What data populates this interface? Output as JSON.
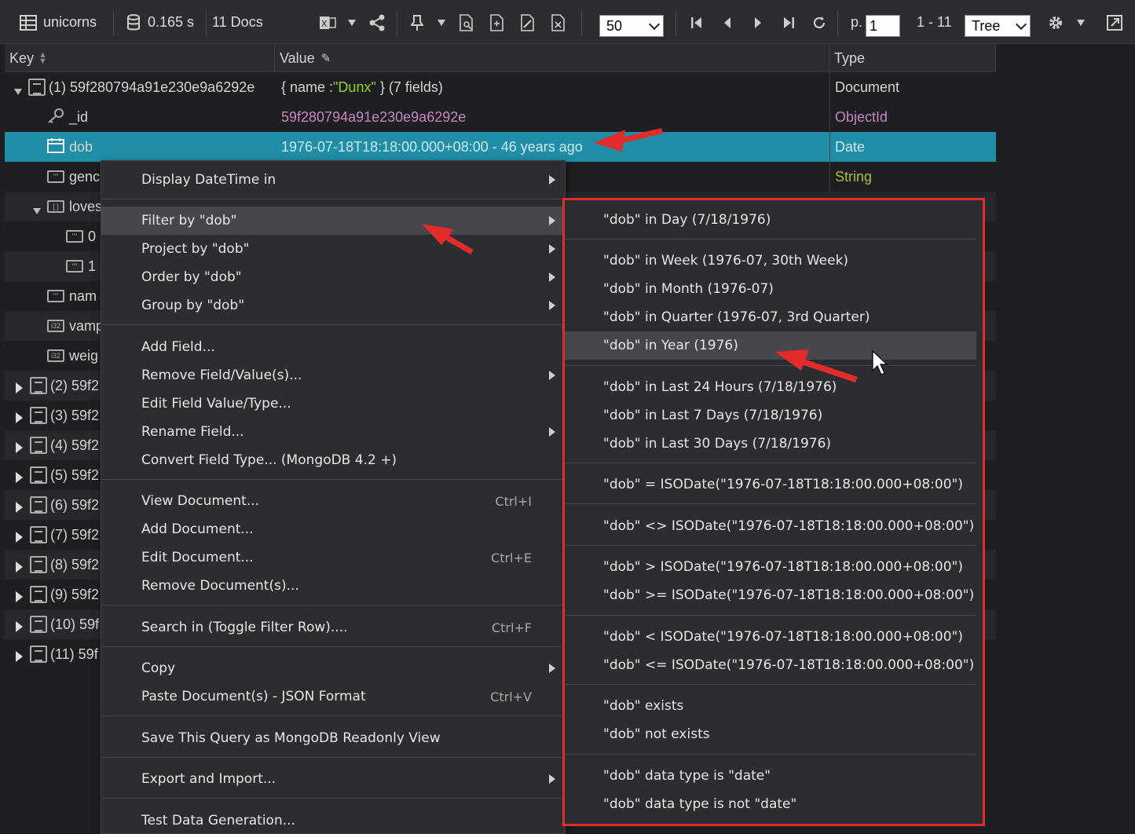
{
  "toolbar": {
    "collection": "unicorns",
    "time": "0.165 s",
    "docs": "11 Docs",
    "page_size": "50",
    "page_label": "p.",
    "page_value": "1",
    "range": "1 - 11",
    "view_mode": "Tree"
  },
  "columns": {
    "key": "Key",
    "value": "Value",
    "type": "Type"
  },
  "rows": [
    {
      "key": "(1) 59f280794a91e230e9a6292e",
      "value_pre": "{ name : ",
      "value_str": "\"Dunx\"",
      "value_post": " } (7 fields)",
      "type": "Document"
    },
    {
      "key": "_id",
      "value": "59f280794a91e230e9a6292e",
      "type": "ObjectId"
    },
    {
      "key": "dob",
      "value": "1976-07-18T18:18:00.000+08:00 - 46 years ago",
      "type": "Date"
    },
    {
      "key": "genc",
      "type": "String"
    },
    {
      "key": "loves"
    },
    {
      "key": "0"
    },
    {
      "key": "1"
    },
    {
      "key": "nam"
    },
    {
      "key": "vamp"
    },
    {
      "key": "weig"
    },
    {
      "key": "(2) 59f2"
    },
    {
      "key": "(3) 59f2"
    },
    {
      "key": "(4) 59f2"
    },
    {
      "key": "(5) 59f2"
    },
    {
      "key": "(6) 59f2"
    },
    {
      "key": "(7) 59f2"
    },
    {
      "key": "(8) 59f2"
    },
    {
      "key": "(9) 59f2"
    },
    {
      "key": "(10) 59f"
    },
    {
      "key": "(11) 59f"
    }
  ],
  "menu": {
    "display_datetime": "Display DateTime in",
    "filter_by": "Filter by \"dob\"",
    "project_by": "Project by \"dob\"",
    "order_by": "Order by \"dob\"",
    "group_by": "Group by \"dob\"",
    "add_field": "Add Field...",
    "remove_field": "Remove Field/Value(s)...",
    "edit_field": "Edit Field Value/Type...",
    "rename_field": "Rename Field...",
    "convert_field": "Convert Field Type... (MongoDB 4.2 +)",
    "view_document": "View Document...",
    "view_document_sc": "Ctrl+I",
    "add_document": "Add Document...",
    "edit_document": "Edit Document...",
    "edit_document_sc": "Ctrl+E",
    "remove_document": "Remove Document(s)...",
    "search_in": "Search in (Toggle Filter Row)....",
    "search_in_sc": "Ctrl+F",
    "copy": "Copy",
    "paste": "Paste Document(s) - JSON Format",
    "paste_sc": "Ctrl+V",
    "save_query": "Save This Query as MongoDB Readonly View",
    "export_import": "Export and Import...",
    "test_data": "Test Data Generation..."
  },
  "submenu": {
    "day": "\"dob\" in Day (7/18/1976)",
    "week": "\"dob\" in Week (1976-07, 30th Week)",
    "month": "\"dob\" in Month (1976-07)",
    "quarter": "\"dob\" in Quarter (1976-07, 3rd Quarter)",
    "year": "\"dob\" in Year (1976)",
    "last24": "\"dob\" in Last 24 Hours (7/18/1976)",
    "last7": "\"dob\" in Last 7 Days (7/18/1976)",
    "last30": "\"dob\" in Last 30 Days (7/18/1976)",
    "eq": "\"dob\" = ISODate(\"1976-07-18T18:18:00.000+08:00\")",
    "ne": "\"dob\" <> ISODate(\"1976-07-18T18:18:00.000+08:00\")",
    "gt": "\"dob\" > ISODate(\"1976-07-18T18:18:00.000+08:00\")",
    "gte": "\"dob\" >= ISODate(\"1976-07-18T18:18:00.000+08:00\")",
    "lt": "\"dob\" < ISODate(\"1976-07-18T18:18:00.000+08:00\")",
    "lte": "\"dob\" <= ISODate(\"1976-07-18T18:18:00.000+08:00\")",
    "exists": "\"dob\" exists",
    "not_exists": "\"dob\" not exists",
    "type_date": "\"dob\" data type is \"date\"",
    "type_not_date": "\"dob\" data type is not \"date\""
  },
  "colors": {
    "selected_row": "#1f8ea6",
    "annotation": "#e22b2b",
    "string": "#9acd32",
    "objectid": "#c586c0"
  }
}
